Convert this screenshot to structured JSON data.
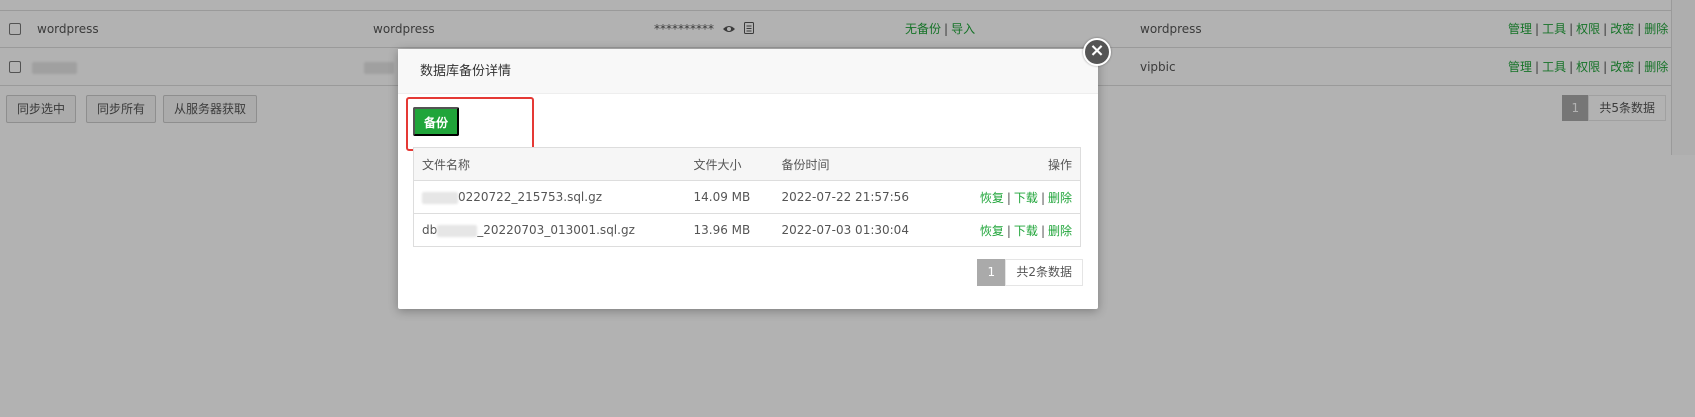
{
  "background": {
    "rows": [
      {
        "name": "wordpress",
        "user": "wordpress",
        "password": "**********",
        "backup": "无备份",
        "import": "导入",
        "note": "wordpress",
        "actions": [
          "管理",
          "工具",
          "权限",
          "改密",
          "删除"
        ]
      },
      {
        "name": "",
        "user": "",
        "note": "vipbic",
        "actions": [
          "管理",
          "工具",
          "权限",
          "改密",
          "删除"
        ]
      }
    ],
    "buttons": {
      "sync_selected": "同步选中",
      "sync_all": "同步所有",
      "fetch_from_server": "从服务器获取"
    },
    "pager": {
      "page": "1",
      "total": "共5条数据"
    }
  },
  "modal": {
    "title": "数据库备份详情",
    "close_label": "×",
    "backup_button": "备份",
    "columns": [
      "文件名称",
      "文件大小",
      "备份时间",
      "操作"
    ],
    "rows": [
      {
        "filename": "0220722_215753.sql.gz",
        "size": "14.09 MB",
        "time": "2022-07-22 21:57:56",
        "actions": [
          "恢复",
          "下载",
          "删除"
        ]
      },
      {
        "filename_prefix": "db",
        "filename": "_20220703_013001.sql.gz",
        "size": "13.96 MB",
        "time": "2022-07-03 01:30:04",
        "actions": [
          "恢复",
          "下载",
          "删除"
        ]
      }
    ],
    "pager": {
      "page": "1",
      "total": "共2条数据"
    }
  },
  "colors": {
    "accent": "#20a53a",
    "highlight": "#e53935"
  }
}
